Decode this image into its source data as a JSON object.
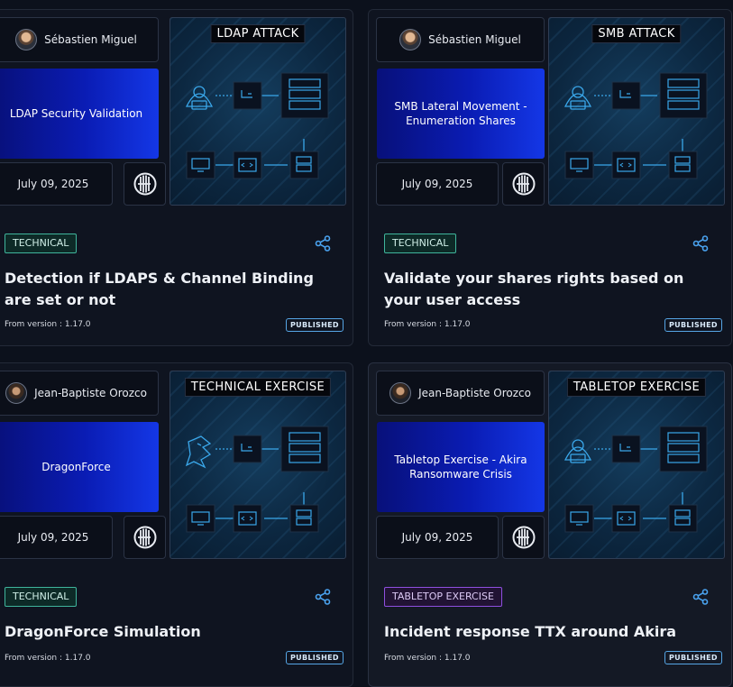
{
  "cards": [
    {
      "author": "Sébastien Miguel",
      "title_box": "LDAP Security Validation",
      "visual_label": "LDAP ATTACK",
      "date": "July 09, 2025",
      "badge": "TECHNICAL",
      "title": "Detection if LDAPS & Channel Binding are set or not",
      "version": "From version : 1.17.0",
      "status": "PUBLISHED"
    },
    {
      "author": "Sébastien Miguel",
      "title_box": "SMB Lateral Movement - Enumeration Shares",
      "visual_label": "SMB ATTACK",
      "date": "July 09, 2025",
      "badge": "TECHNICAL",
      "title": "Validate your shares rights based on your user access",
      "version": "From version : 1.17.0",
      "status": "PUBLISHED"
    },
    {
      "author": "Jean-Baptiste Orozco",
      "title_box": "DragonForce",
      "visual_label": "TECHNICAL EXERCISE",
      "date": "July 09, 2025",
      "badge": "TECHNICAL",
      "title": "DragonForce Simulation",
      "version": "From version : 1.17.0",
      "status": "PUBLISHED"
    },
    {
      "author": "Jean-Baptiste Orozco",
      "title_box": "Tabletop Exercise - Akira Ransomware Crisis",
      "visual_label": "TABLETOP EXERCISE",
      "date": "July 09, 2025",
      "badge": "TABLETOP EXERCISE",
      "title": "Incident response TTX around Akira",
      "version": "From version : 1.17.0",
      "status": "PUBLISHED"
    }
  ],
  "colors": {
    "technical_badge": "#3fb59c",
    "tabletop_badge": "#8f4fe0",
    "published_border": "#56a6e6",
    "visual_accent": "#2f9fe0"
  },
  "icons": {
    "share": "share-icon",
    "hacker": "hacker-icon",
    "dragon": "dragon-icon",
    "server": "server-icon",
    "network": "network-icon",
    "monitor": "monitor-icon",
    "code": "code-icon",
    "logo": "platform-logo-icon"
  }
}
